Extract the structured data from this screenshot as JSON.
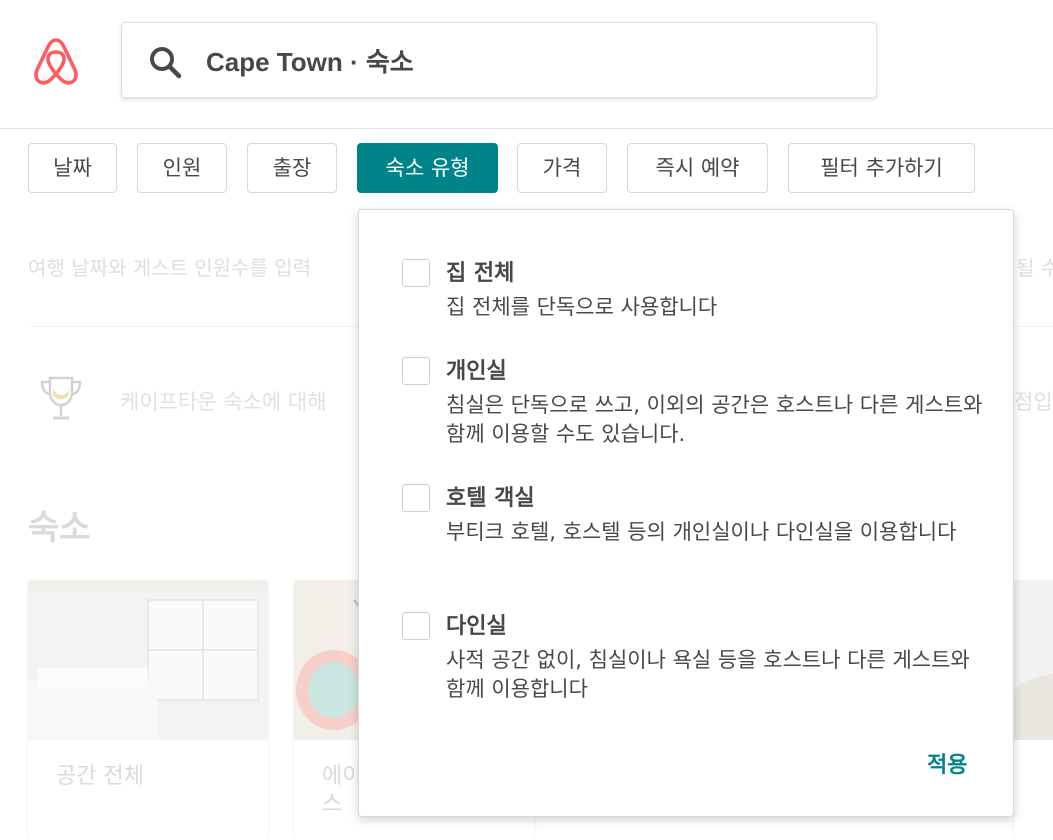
{
  "header": {
    "search_text": "Cape Town · 숙소"
  },
  "filters": [
    {
      "label": "날짜",
      "active": false
    },
    {
      "label": "인원",
      "active": false
    },
    {
      "label": "출장",
      "active": false
    },
    {
      "label": "숙소 유형",
      "active": true
    },
    {
      "label": "가격",
      "active": false
    },
    {
      "label": "즉시 예약",
      "active": false
    },
    {
      "label": "필터 추가하기",
      "active": false
    }
  ],
  "background": {
    "notice": "여행 날짜와 게스트 인원수를 입력",
    "notice_right": "될 수",
    "promo": "케이프타운 숙소에 대해",
    "promo_right": "점입",
    "section_heading": "숙소",
    "cards": [
      {
        "label": "공간 전체"
      },
      {
        "label": "에이",
        "label2": "스"
      }
    ]
  },
  "dropdown": {
    "options": [
      {
        "title": "집 전체",
        "description": "집 전체를 단독으로 사용합니다",
        "checked": false
      },
      {
        "title": "개인실",
        "description": "침실은 단독으로 쓰고, 이외의 공간은 호스트나 다른 게스트와 함께 이용할 수도 있습니다.",
        "checked": false
      },
      {
        "title": "호텔 객실",
        "description": "부티크 호텔, 호스텔 등의 개인실이나 다인실을 이용합니다",
        "checked": false
      },
      {
        "title": "다인실",
        "description": "사적 공간 없이, 침실이나 욕실 등을 호스트나 다른 게스트와 함께 이용합니다",
        "checked": false
      }
    ],
    "apply_label": "적용"
  },
  "colors": {
    "brand": "#FF5A5F",
    "accent": "#008489",
    "text": "#484848",
    "border": "#D8D8D8"
  }
}
